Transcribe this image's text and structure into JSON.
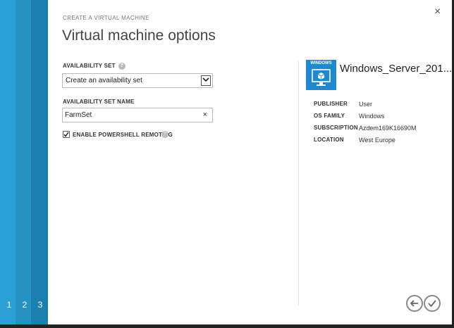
{
  "steps": [
    "1",
    "2",
    "3"
  ],
  "header": {
    "subtitle": "CREATE A VIRTUAL MACHINE",
    "title": "Virtual machine options"
  },
  "close_symbol": "×",
  "form": {
    "availability_set_label": "AVAILABILITY SET",
    "availability_set_value": "Create an availability set",
    "availability_set_name_label": "AVAILABILITY SET NAME",
    "availability_set_name_value": "FarmSet",
    "clear_symbol": "×",
    "powershell_label": "ENABLE POWERSHELL REMOTING",
    "powershell_checked": true,
    "help_symbol": "?"
  },
  "image": {
    "tile_label": "WINDOWS",
    "name": "Windows_Server_201...",
    "tile_color": "#1e88d0",
    "details": [
      {
        "key": "PUBLISHER",
        "value": "User"
      },
      {
        "key": "OS FAMILY",
        "value": "Windows"
      },
      {
        "key": "SUBSCRIPTION",
        "value": "Azdem169K16690M"
      },
      {
        "key": "LOCATION",
        "value": "West Europe"
      }
    ]
  },
  "nav": {
    "back_icon": "arrow-left-icon",
    "next_icon": "check-icon"
  },
  "colors": {
    "rail_1": "#2aa0d4",
    "rail_2": "#2592c4",
    "rail_3": "#1b7fb0"
  }
}
